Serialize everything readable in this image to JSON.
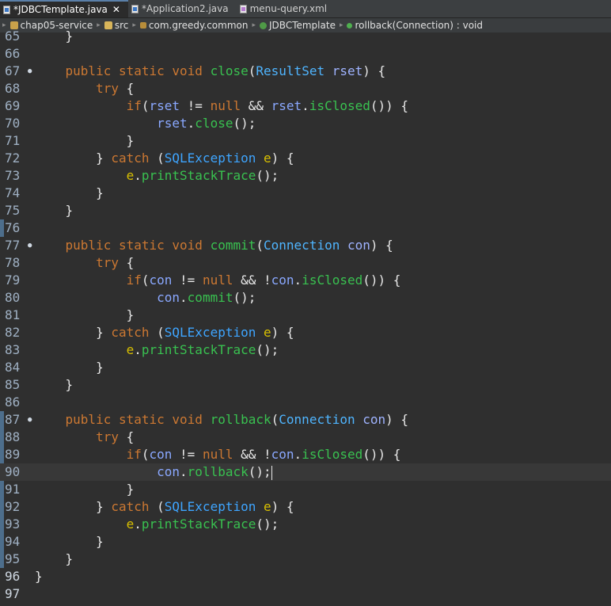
{
  "tabs": [
    {
      "label": "*JDBCTemplate.java",
      "active": true,
      "icon": "java-file-icon",
      "closable": true
    },
    {
      "label": "*Application2.java",
      "active": false,
      "icon": "java-file-icon",
      "closable": false
    },
    {
      "label": "menu-query.xml",
      "active": false,
      "icon": "xml-file-icon",
      "closable": false
    }
  ],
  "breadcrumb": [
    "chap05-service",
    "src",
    "com.greedy.common",
    "JDBCTemplate",
    "rollback(Connection) : void"
  ],
  "editor": {
    "current_line": 90,
    "lines": [
      {
        "n": "65",
        "tokens": [
          [
            "pu",
            "    }"
          ]
        ]
      },
      {
        "n": "66",
        "tokens": []
      },
      {
        "n": "67",
        "fold": true,
        "tokens": [
          [
            "pl",
            "    "
          ],
          [
            "kw",
            "public"
          ],
          [
            "pl",
            " "
          ],
          [
            "kw",
            "static"
          ],
          [
            "pl",
            " "
          ],
          [
            "kw",
            "void"
          ],
          [
            "pl",
            " "
          ],
          [
            "mt",
            "close"
          ],
          [
            "pu",
            "("
          ],
          [
            "ty",
            "ResultSet"
          ],
          [
            "pl",
            " "
          ],
          [
            "pa",
            "rset"
          ],
          [
            "pu",
            ") {"
          ]
        ]
      },
      {
        "n": "68",
        "tokens": [
          [
            "pl",
            "        "
          ],
          [
            "kw",
            "try"
          ],
          [
            "pu",
            " {"
          ]
        ]
      },
      {
        "n": "69",
        "tokens": [
          [
            "pl",
            "            "
          ],
          [
            "kw",
            "if"
          ],
          [
            "pu",
            "("
          ],
          [
            "vr",
            "rset"
          ],
          [
            "pu",
            " != "
          ],
          [
            "kw",
            "null"
          ],
          [
            "pu",
            " && "
          ],
          [
            "vr",
            "rset"
          ],
          [
            "pu",
            "."
          ],
          [
            "mt",
            "isClosed"
          ],
          [
            "pu",
            "()) {"
          ]
        ]
      },
      {
        "n": "70",
        "tokens": [
          [
            "pl",
            "                "
          ],
          [
            "vr",
            "rset"
          ],
          [
            "pu",
            "."
          ],
          [
            "mt",
            "close"
          ],
          [
            "pu",
            "();"
          ]
        ]
      },
      {
        "n": "71",
        "tokens": [
          [
            "pu",
            "            }"
          ]
        ]
      },
      {
        "n": "72",
        "tokens": [
          [
            "pu",
            "        } "
          ],
          [
            "kw",
            "catch"
          ],
          [
            "pu",
            " ("
          ],
          [
            "ex",
            "SQLException"
          ],
          [
            "pl",
            " "
          ],
          [
            "ev",
            "e"
          ],
          [
            "pu",
            ") {"
          ]
        ]
      },
      {
        "n": "73",
        "tokens": [
          [
            "pl",
            "            "
          ],
          [
            "ev",
            "e"
          ],
          [
            "pu",
            "."
          ],
          [
            "mt",
            "printStackTrace"
          ],
          [
            "pu",
            "();"
          ]
        ]
      },
      {
        "n": "74",
        "tokens": [
          [
            "pu",
            "        }"
          ]
        ]
      },
      {
        "n": "75",
        "tokens": [
          [
            "pu",
            "    }"
          ]
        ]
      },
      {
        "n": "76",
        "tokens": []
      },
      {
        "n": "77",
        "fold": true,
        "tokens": [
          [
            "pl",
            "    "
          ],
          [
            "kw",
            "public"
          ],
          [
            "pl",
            " "
          ],
          [
            "kw",
            "static"
          ],
          [
            "pl",
            " "
          ],
          [
            "kw",
            "void"
          ],
          [
            "pl",
            " "
          ],
          [
            "mt",
            "commit"
          ],
          [
            "pu",
            "("
          ],
          [
            "ty",
            "Connection"
          ],
          [
            "pl",
            " "
          ],
          [
            "pa",
            "con"
          ],
          [
            "pu",
            ") {"
          ]
        ]
      },
      {
        "n": "78",
        "tokens": [
          [
            "pl",
            "        "
          ],
          [
            "kw",
            "try"
          ],
          [
            "pu",
            " {"
          ]
        ]
      },
      {
        "n": "79",
        "tokens": [
          [
            "pl",
            "            "
          ],
          [
            "kw",
            "if"
          ],
          [
            "pu",
            "("
          ],
          [
            "vr",
            "con"
          ],
          [
            "pu",
            " != "
          ],
          [
            "kw",
            "null"
          ],
          [
            "pu",
            " && !"
          ],
          [
            "vr",
            "con"
          ],
          [
            "pu",
            "."
          ],
          [
            "mt",
            "isClosed"
          ],
          [
            "pu",
            "()) {"
          ]
        ]
      },
      {
        "n": "80",
        "tokens": [
          [
            "pl",
            "                "
          ],
          [
            "vr",
            "con"
          ],
          [
            "pu",
            "."
          ],
          [
            "mt",
            "commit"
          ],
          [
            "pu",
            "();"
          ]
        ]
      },
      {
        "n": "81",
        "tokens": [
          [
            "pu",
            "            }"
          ]
        ]
      },
      {
        "n": "82",
        "tokens": [
          [
            "pu",
            "        } "
          ],
          [
            "kw",
            "catch"
          ],
          [
            "pu",
            " ("
          ],
          [
            "ex",
            "SQLException"
          ],
          [
            "pl",
            " "
          ],
          [
            "ev",
            "e"
          ],
          [
            "pu",
            ") {"
          ]
        ]
      },
      {
        "n": "83",
        "tokens": [
          [
            "pl",
            "            "
          ],
          [
            "ev",
            "e"
          ],
          [
            "pu",
            "."
          ],
          [
            "mt",
            "printStackTrace"
          ],
          [
            "pu",
            "();"
          ]
        ]
      },
      {
        "n": "84",
        "tokens": [
          [
            "pu",
            "        }"
          ]
        ]
      },
      {
        "n": "85",
        "tokens": [
          [
            "pu",
            "    }"
          ]
        ]
      },
      {
        "n": "86",
        "tokens": []
      },
      {
        "n": "87",
        "fold": true,
        "tokens": [
          [
            "pl",
            "    "
          ],
          [
            "kw",
            "public"
          ],
          [
            "pl",
            " "
          ],
          [
            "kw",
            "static"
          ],
          [
            "pl",
            " "
          ],
          [
            "kw",
            "void"
          ],
          [
            "pl",
            " "
          ],
          [
            "mt",
            "rollback"
          ],
          [
            "pu",
            "("
          ],
          [
            "ty",
            "Connection"
          ],
          [
            "pl",
            " "
          ],
          [
            "pa",
            "con"
          ],
          [
            "pu",
            ") {"
          ]
        ]
      },
      {
        "n": "88",
        "tokens": [
          [
            "pl",
            "        "
          ],
          [
            "kw",
            "try"
          ],
          [
            "pu",
            " {"
          ]
        ]
      },
      {
        "n": "89",
        "tokens": [
          [
            "pl",
            "            "
          ],
          [
            "kw",
            "if"
          ],
          [
            "pu",
            "("
          ],
          [
            "vr",
            "con"
          ],
          [
            "pu",
            " != "
          ],
          [
            "kw",
            "null"
          ],
          [
            "pu",
            " && !"
          ],
          [
            "vr",
            "con"
          ],
          [
            "pu",
            "."
          ],
          [
            "mt",
            "isClosed"
          ],
          [
            "pu",
            "()) {"
          ]
        ]
      },
      {
        "n": "90",
        "tokens": [
          [
            "pl",
            "                "
          ],
          [
            "vr",
            "con"
          ],
          [
            "pu",
            "."
          ],
          [
            "mt",
            "rollback"
          ],
          [
            "pu",
            "();"
          ]
        ],
        "caret": true
      },
      {
        "n": "91",
        "tokens": [
          [
            "pu",
            "            }"
          ]
        ]
      },
      {
        "n": "92",
        "tokens": [
          [
            "pu",
            "        } "
          ],
          [
            "kw",
            "catch"
          ],
          [
            "pu",
            " ("
          ],
          [
            "ex",
            "SQLException"
          ],
          [
            "pl",
            " "
          ],
          [
            "ev",
            "e"
          ],
          [
            "pu",
            ") {"
          ]
        ]
      },
      {
        "n": "93",
        "tokens": [
          [
            "pl",
            "            "
          ],
          [
            "ev",
            "e"
          ],
          [
            "pu",
            "."
          ],
          [
            "mt",
            "printStackTrace"
          ],
          [
            "pu",
            "();"
          ]
        ]
      },
      {
        "n": "94",
        "tokens": [
          [
            "pu",
            "        }"
          ]
        ]
      },
      {
        "n": "95",
        "tokens": [
          [
            "pu",
            "    }"
          ]
        ]
      },
      {
        "n": "96",
        "tokens": [
          [
            "pu",
            "}"
          ]
        ]
      },
      {
        "n": "97",
        "tokens": []
      }
    ]
  },
  "colors": {
    "background": "#2f2f2f",
    "keyword": "#cc7832",
    "method": "#39c150",
    "type": "#4fb5ff",
    "variable": "#8aa8ff",
    "exception_var": "#d9c000",
    "change_marker": "#4d6e8c"
  }
}
